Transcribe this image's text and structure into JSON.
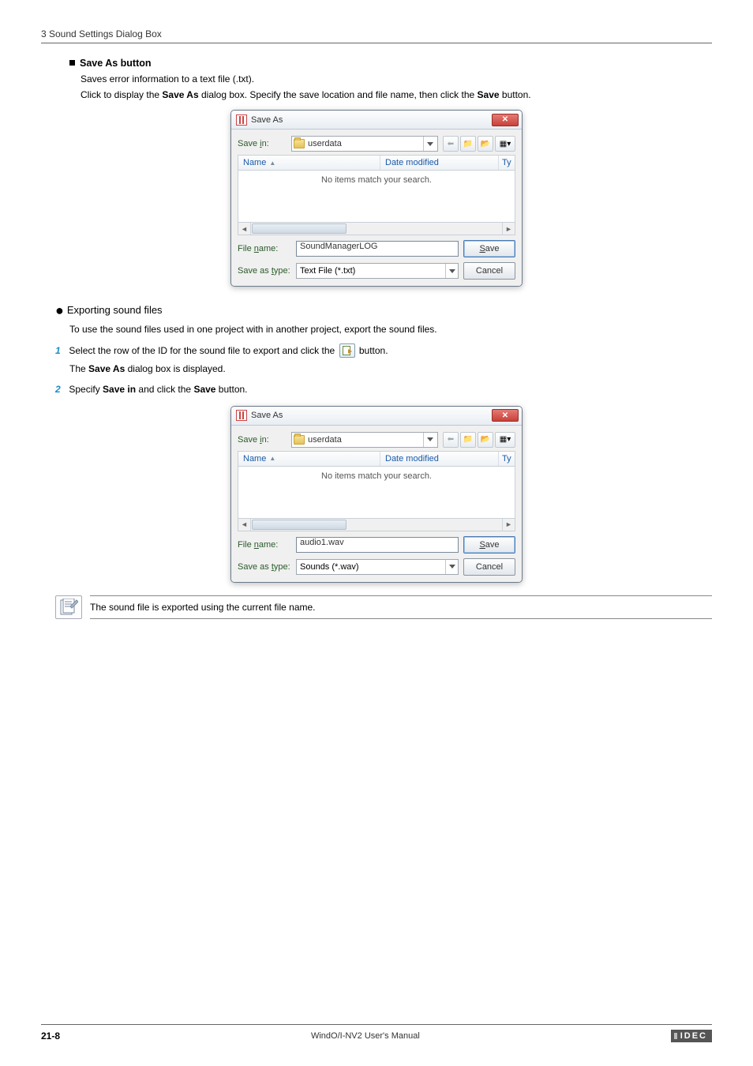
{
  "header": {
    "section_title": "3 Sound Settings Dialog Box"
  },
  "sec_saveas": {
    "heading": "Save As button",
    "line1": "Saves error information to a text file (.txt).",
    "line2a": "Click to display the ",
    "line2b": "Save As",
    "line2c": " dialog box. Specify the save location and file name, then click the ",
    "line2d": "Save",
    "line2e": " button."
  },
  "dialog_common": {
    "title": "Save As",
    "save_in_label": "Save in:",
    "save_in_value": "userdata",
    "col_name": "Name",
    "col_date": "Date modified",
    "col_ty": "Ty",
    "empty_msg": "No items match your search.",
    "file_name_label": "File name:",
    "save_as_type_label": "Save as type:",
    "save_btn": "Save",
    "cancel_btn": "Cancel"
  },
  "dialog1": {
    "file_name": "SoundManagerLOG",
    "save_as_type": "Text File (*.txt)"
  },
  "sec_export": {
    "heading": "Exporting sound files",
    "line1": "To use the sound files used in one project with in another project, export the sound files.",
    "step1_num": "1",
    "step1a": "Select the row of the ID for the sound file to export and click the ",
    "step1b": " button.",
    "step1_sub_a": "The ",
    "step1_sub_b": "Save As",
    "step1_sub_c": " dialog box is displayed.",
    "step2_num": "2",
    "step2a": "Specify ",
    "step2b": "Save in",
    "step2c": " and click the ",
    "step2d": "Save",
    "step2e": " button."
  },
  "dialog2": {
    "file_name": "audio1.wav",
    "save_as_type": "Sounds (*.wav)"
  },
  "note": {
    "text": "The sound file is exported using the current file name."
  },
  "footer": {
    "page": "21-8",
    "manual": "WindO/I-NV2 User's Manual",
    "brand": "IDEC"
  }
}
